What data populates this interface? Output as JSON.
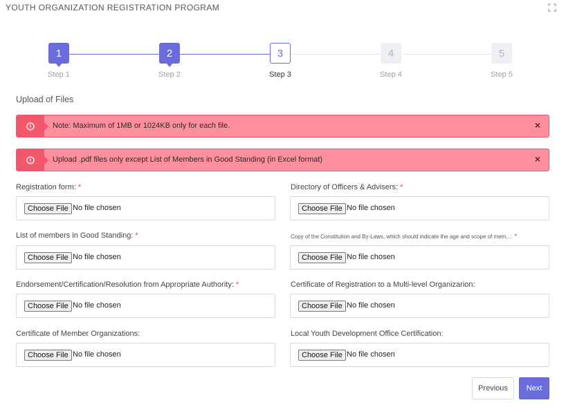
{
  "header": {
    "title": "YOUTH ORGANIZATION REGISTRATION PROGRAM"
  },
  "colors": {
    "accent": "#6b6cdb",
    "alert_bg": "#fe8f9c",
    "alert_border": "#f4566c",
    "required": "#ee4444"
  },
  "stepper": {
    "steps": [
      {
        "number": "1",
        "label": "Step 1",
        "state": "done"
      },
      {
        "number": "2",
        "label": "Step 2",
        "state": "done"
      },
      {
        "number": "3",
        "label": "Step 3",
        "state": "current"
      },
      {
        "number": "4",
        "label": "Step 4",
        "state": "todo"
      },
      {
        "number": "5",
        "label": "Step 5",
        "state": "todo"
      }
    ]
  },
  "section": {
    "title": "Upload of Files"
  },
  "alerts": [
    {
      "message": "Note: Maximum of 1MB or 1024KB only for each file.",
      "close": "×"
    },
    {
      "message": "Upload .pdf files only except List of Members in Good Standing (in Excel format)",
      "close": "×"
    }
  ],
  "fields": [
    {
      "label": "Registration form:",
      "required": "*",
      "button": "Choose File",
      "status": "No file chosen"
    },
    {
      "label": "Directory of Officers & Advisers:",
      "required": "*",
      "button": "Choose File",
      "status": "No file chosen"
    },
    {
      "label": "List of members in Good Standing:",
      "required": "*",
      "button": "Choose File",
      "status": "No file chosen"
    },
    {
      "label": "Copy of the Constitution and By-Laws, which should indicate the age and scope of mem...:",
      "required": "*",
      "button": "Choose File",
      "status": "No file chosen"
    },
    {
      "label": "Endorsement/Certification/Resolution from Appropriate Authority:",
      "required": "*",
      "button": "Choose File",
      "status": "No file chosen"
    },
    {
      "label": "Certificate of Registration to a Multi-level Organizarion:",
      "required": "",
      "button": "Choose File",
      "status": "No file chosen"
    },
    {
      "label": "Certificate of Member Organizations:",
      "required": "",
      "button": "Choose File",
      "status": "No file chosen"
    },
    {
      "label": "Local Youth Development Office Certification:",
      "required": "",
      "button": "Choose File",
      "status": "No file chosen"
    }
  ],
  "buttons": {
    "previous": "Previous",
    "next": "Next"
  }
}
